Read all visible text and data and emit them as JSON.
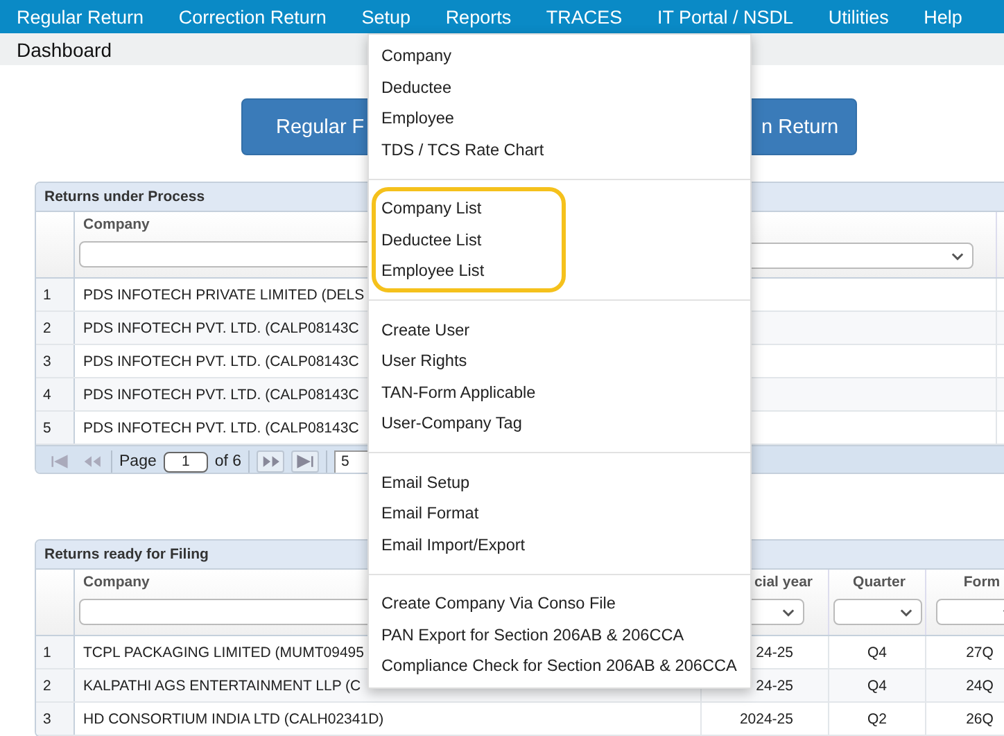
{
  "nav": [
    {
      "label": "Regular Return"
    },
    {
      "label": "Correction Return"
    },
    {
      "label": "Setup"
    },
    {
      "label": "Reports"
    },
    {
      "label": "TRACES"
    },
    {
      "label": "IT Portal / NSDL"
    },
    {
      "label": "Utilities"
    },
    {
      "label": "Help"
    }
  ],
  "breadcrumb": "Dashboard",
  "action_buttons": [
    {
      "label": "Regular F"
    },
    {
      "label": "n Return"
    }
  ],
  "under_process": {
    "title": "Returns under Process",
    "columns": [
      "Company"
    ],
    "rows": [
      {
        "num": "1",
        "company": "PDS INFOTECH PRIVATE LIMITED (DELS"
      },
      {
        "num": "2",
        "company": "PDS INFOTECH PVT. LTD. (CALP08143C"
      },
      {
        "num": "3",
        "company": "PDS INFOTECH PVT. LTD. (CALP08143C"
      },
      {
        "num": "4",
        "company": "PDS INFOTECH PVT. LTD. (CALP08143C"
      },
      {
        "num": "5",
        "company": "PDS INFOTECH PVT. LTD. (CALP08143C"
      }
    ],
    "pager": {
      "page_label": "Page",
      "page": "1",
      "of_label": "of 6",
      "page_size": "5"
    }
  },
  "ready_for_filing": {
    "title": "Returns ready for Filing",
    "columns": [
      "Company",
      "cial year",
      "Quarter",
      "Form"
    ],
    "rows": [
      {
        "num": "1",
        "company": "TCPL PACKAGING LIMITED (MUMT09495",
        "year": "24-25",
        "quarter": "Q4",
        "form": "27Q"
      },
      {
        "num": "2",
        "company": "KALPATHI AGS ENTERTAINMENT LLP (C",
        "year": "24-25",
        "quarter": "Q4",
        "form": "24Q"
      },
      {
        "num": "3",
        "company": "HD CONSORTIUM INDIA LTD (CALH02341D)",
        "year": "2024-25",
        "quarter": "Q2",
        "form": "26Q"
      }
    ]
  },
  "setup_menu": {
    "groups": [
      {
        "highlighted": false,
        "items": [
          "Company",
          "Deductee",
          "Employee",
          "TDS / TCS Rate Chart"
        ]
      },
      {
        "highlighted": true,
        "items": [
          "Company List",
          "Deductee List",
          "Employee List"
        ]
      },
      {
        "highlighted": false,
        "items": [
          "Create User",
          "User Rights",
          "TAN-Form Applicable",
          "User-Company Tag"
        ]
      },
      {
        "highlighted": false,
        "items": [
          "Email Setup",
          "Email Format",
          "Email Import/Export"
        ]
      },
      {
        "highlighted": false,
        "items": [
          "Create Company Via Conso File",
          "PAN Export for Section 206AB & 206CCA",
          "Compliance Check for Section 206AB & 206CCA"
        ]
      }
    ]
  }
}
